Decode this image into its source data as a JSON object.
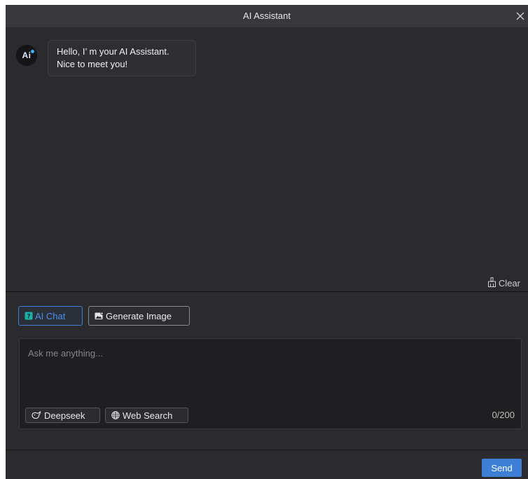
{
  "window": {
    "title": "AI Assistant",
    "close_icon": "close-icon"
  },
  "chat": {
    "assistant_avatar": {
      "text": "Ai",
      "icon": "ai-logo-icon"
    },
    "messages": [
      {
        "role": "assistant",
        "line1": "Hello, I’ m your AI Assistant.",
        "line2": "Nice to meet you!"
      }
    ],
    "clear_label": "Clear",
    "clear_icon": "broom-icon"
  },
  "modes": {
    "ai_chat": {
      "label": "AI Chat",
      "icon": "ai-chat-icon",
      "active": true
    },
    "generate_image": {
      "label": "Generate Image",
      "icon": "image-add-icon",
      "active": false
    }
  },
  "composer": {
    "placeholder": "Ask me anything...",
    "value": "",
    "deepseek_label": "Deepseek",
    "deepseek_icon": "whale-icon",
    "web_search_label": "Web Search",
    "web_search_icon": "globe-icon",
    "counter": "0/200"
  },
  "footer": {
    "send_label": "Send"
  },
  "colors": {
    "background": "#2b2b2f",
    "titlebar": "#38383c",
    "accent": "#3d7fd5",
    "input_bg": "#1f1f22"
  }
}
